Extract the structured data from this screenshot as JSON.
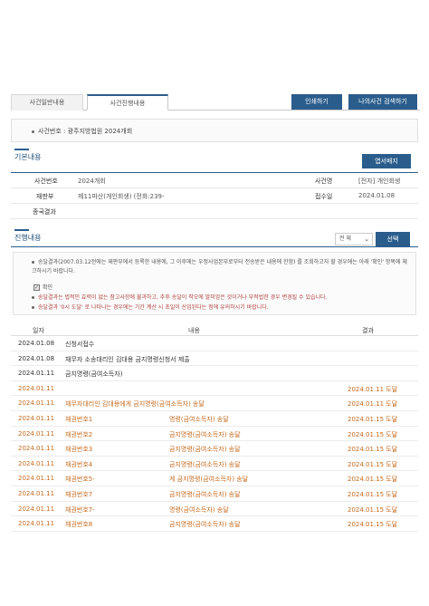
{
  "tabs": [
    "사건일반내용",
    "사건진행내용"
  ],
  "buttons": {
    "print": "인쇄하기",
    "my_case": "나의사건 검색하기",
    "postcard": "엽서배지",
    "select": "선택"
  },
  "case_no": "사건번호 : 광주지방법원 2024개회",
  "sections": {
    "basic": "기본내용",
    "progress": "진행내용"
  },
  "basic": {
    "case_no_label": "사건번호",
    "case_no_value": "2024개회",
    "case_name_label": "사건명",
    "case_name_value": "[전자] 개인회생",
    "court_label": "재판부",
    "court_value": "제11파산(개인회생) (전화:239-",
    "receipt_label": "접수일",
    "receipt_value": "2024.01.08",
    "result_label": "종국결과",
    "result_value": ""
  },
  "filter": {
    "selected": "전 체"
  },
  "notice": {
    "line1": "송달결과(2007.03.12전에는 재판부에서 등록한 내용에, 그 이후에는 우정사업본부로부터 전송받은 내용에 한함) 를 조회하고자 할 경우에는 아래 '확인' 항목에 체크하시기 바랍니다.",
    "check_label": "확인",
    "line2": "송달결과는 법적인 효력이 없는 참고사항에 불과하고, 추후 송달이 착오에 말미암은 것이거나 부적법한 경우 변경될 수 있습니다.",
    "line3": "송달결과 '0시 도달' 로 나타나는 경우에는 기간 계산 시 초일이 산입된다는 점에 유의하시기 바랍니다."
  },
  "table": {
    "headers": [
      "일자",
      "내용",
      "결과"
    ],
    "rows": [
      {
        "date": "2024.01.08",
        "content": "신청서접수",
        "content2": "",
        "result": "",
        "style": "normal"
      },
      {
        "date": "2024.01.08",
        "content": "채무자 소송대리인 김대용 금지명령신청서 제출",
        "content2": "",
        "result": "",
        "style": "normal"
      },
      {
        "date": "2024.01.11",
        "content": "금지명령(금여소득자)",
        "content2": "",
        "result": "",
        "style": "normal"
      },
      {
        "date": "2024.01.11",
        "content": "",
        "content2": "",
        "result": "2024.01.11 도달",
        "style": "orange"
      },
      {
        "date": "2024.01.11",
        "content": "채무자대리인 김대용에게 금지명령(금여소득자) 송달",
        "content2": "",
        "result": "2024.01.11 도달",
        "style": "orange"
      },
      {
        "date": "2024.01.11",
        "content": "채권번호1",
        "content2": "명령(금여소득자) 송달",
        "result": "2024.01.15 도달",
        "style": "orange"
      },
      {
        "date": "2024.01.11",
        "content": "채권번호2",
        "content2": "금지명령(금여소득자) 송달",
        "result": "2024.01.15 도달",
        "style": "orange"
      },
      {
        "date": "2024.01.11",
        "content": "채권번호3",
        "content2": "금지명령(금여소득자) 송달",
        "result": "2024.01.15 도달",
        "style": "orange"
      },
      {
        "date": "2024.01.11",
        "content": "채권번호4",
        "content2": "금지명령(금여소득자) 송달",
        "result": "2024.01.15 도달",
        "style": "orange"
      },
      {
        "date": "2024.01.11",
        "content": "채권번호5-",
        "content2": "게 금지명령(금여소득자) 송달",
        "result": "2024.01.15 도달",
        "style": "orange"
      },
      {
        "date": "2024.01.11",
        "content": "채권번호7",
        "content2": "금지명령(금여소득자) 송달",
        "result": "2024.01.15 도달",
        "style": "orange"
      },
      {
        "date": "2024.01.11",
        "content": "채권번호7-",
        "content2": "명령(금여소득자) 송달",
        "result": "2024.01.15 도달",
        "style": "orange"
      },
      {
        "date": "2024.01.11",
        "content": "채권번호8",
        "content2": "금지명령(금여소득자) 송달",
        "result": "2024.01.15 도달",
        "style": "orange"
      }
    ]
  }
}
